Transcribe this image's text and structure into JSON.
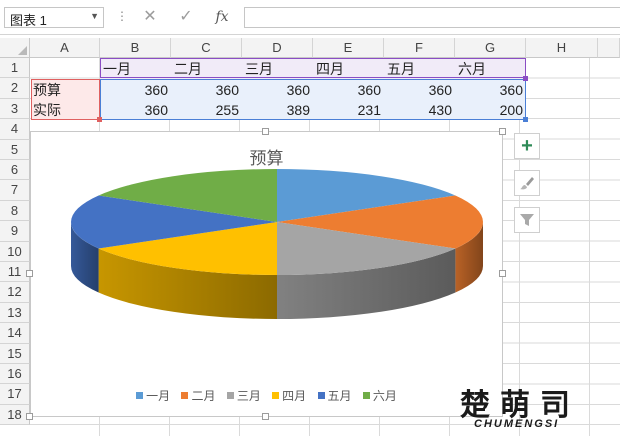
{
  "formula_bar": {
    "name_box": "图表 1",
    "fx_label": "fx",
    "formula_value": ""
  },
  "columns": [
    "A",
    "B",
    "C",
    "D",
    "E",
    "F",
    "G",
    "H"
  ],
  "rows": [
    "1",
    "2",
    "3",
    "4",
    "5",
    "6",
    "7",
    "8",
    "9",
    "10",
    "11",
    "12",
    "13",
    "14",
    "15",
    "16",
    "17",
    "18"
  ],
  "sheet": {
    "header_row": [
      "",
      "一月",
      "二月",
      "三月",
      "四月",
      "五月",
      "六月"
    ],
    "data_rows": [
      {
        "label": "预算",
        "values": [
          "360",
          "360",
          "360",
          "360",
          "360",
          "360"
        ]
      },
      {
        "label": "实际",
        "values": [
          "360",
          "255",
          "389",
          "231",
          "430",
          "200"
        ]
      }
    ]
  },
  "colors": {
    "series": [
      "#5b9bd5",
      "#ed7d31",
      "#a5a5a5",
      "#ffc000",
      "#4472c4",
      "#70ad47"
    ],
    "selection_purple": "#8a4dc4",
    "selection_red": "#e06060",
    "selection_blue": "#4a7fd6"
  },
  "chart_data": {
    "type": "pie",
    "title": "预算",
    "categories": [
      "一月",
      "二月",
      "三月",
      "四月",
      "五月",
      "六月"
    ],
    "values": [
      360,
      360,
      360,
      360,
      360,
      360
    ],
    "style": "3d",
    "legend": "bottom"
  },
  "chart_buttons": [
    "chart-elements",
    "chart-styles",
    "chart-filters"
  ],
  "watermark": {
    "main": "楚萌司",
    "sub": "CHUMENGSI"
  }
}
